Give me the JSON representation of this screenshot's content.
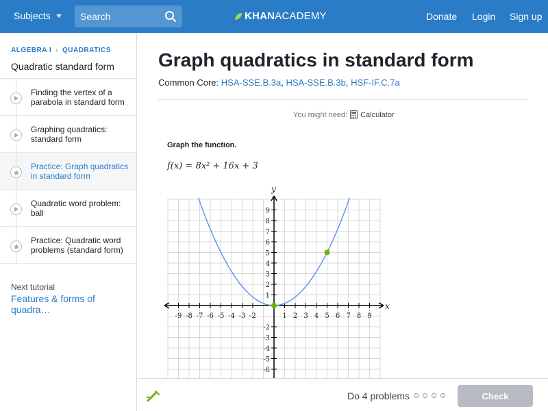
{
  "header": {
    "subjects_label": "Subjects",
    "search_placeholder": "Search",
    "logo_bold": "KHAN",
    "logo_rest": "ACADEMY",
    "donate": "Donate",
    "login": "Login",
    "signup": "Sign up",
    "accent_color": "#2a7cc7"
  },
  "sidebar": {
    "crumb_1": "ALGEBRA I",
    "crumb_2": "QUADRATICS",
    "title": "Quadratic standard form",
    "items": [
      {
        "label": "Finding the vertex of a parabola in standard form",
        "icon": "play-icon"
      },
      {
        "label": "Graphing quadratics: standard form",
        "icon": "play-icon"
      },
      {
        "label": "Practice: Graph quadratics in standard form",
        "icon": "star-icon",
        "active": true
      },
      {
        "label": "Quadratic word problem: ball",
        "icon": "play-icon"
      },
      {
        "label": "Practice: Quadratic word problems (standard form)",
        "icon": "star-icon"
      }
    ],
    "next_label": "Next tutorial",
    "next_link": "Features & forms of quadra…"
  },
  "main": {
    "title": "Graph quadratics in standard form",
    "cc_label": "Common Core:",
    "cc_1": "HSA-SSE.B.3a",
    "cc_2": "HSA-SSE.B.3b",
    "cc_3": "HSF-IF.C.7a",
    "need_label": "You might need:",
    "calculator": "Calculator",
    "prompt": "Graph the function.",
    "function_text": "f(x) = 8x² + 16x + 3"
  },
  "graph": {
    "x_axis_label": "x",
    "y_axis_label": "y",
    "x_ticks": [
      "-9",
      "-8",
      "-7",
      "-6",
      "-5",
      "-4",
      "-3",
      "-2",
      "1",
      "2",
      "3",
      "4",
      "5",
      "6",
      "7",
      "8",
      "9"
    ],
    "y_ticks": [
      "9",
      "8",
      "7",
      "6",
      "5",
      "4",
      "3",
      "2",
      "1",
      "-2",
      "-3",
      "-4",
      "-5",
      "-6"
    ],
    "points": [
      {
        "x": 0,
        "y": 0
      },
      {
        "x": 5,
        "y": 5
      }
    ],
    "curve_color": "#6495ed",
    "point_color": "#71b307"
  },
  "footer": {
    "do_problems": "Do 4 problems",
    "check_label": "Check"
  }
}
